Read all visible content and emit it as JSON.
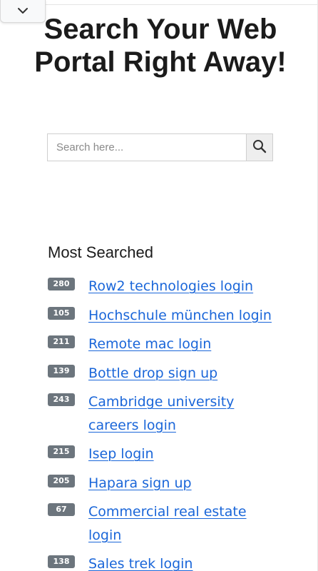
{
  "hero": {
    "title": "Search Your Web Portal Right Away!"
  },
  "search": {
    "placeholder": "Search here...",
    "value": ""
  },
  "most_searched": {
    "heading": "Most Searched",
    "items": [
      {
        "count": "280",
        "label": "Row2 technologies login"
      },
      {
        "count": "105",
        "label": "Hochschule münchen login"
      },
      {
        "count": "211",
        "label": "Remote mac login"
      },
      {
        "count": "139",
        "label": "Bottle drop sign up"
      },
      {
        "count": "243",
        "label": "Cambridge university careers login"
      },
      {
        "count": "215",
        "label": "Isep login"
      },
      {
        "count": "205",
        "label": "Hapara sign up"
      },
      {
        "count": "67",
        "label": "Commercial real estate login"
      },
      {
        "count": "138",
        "label": "Sales trek login"
      }
    ]
  },
  "colors": {
    "link": "#1a66d9",
    "badge": "#6c757d",
    "title": "#1b1b1b"
  },
  "icons": {
    "collapse": "chevron-down-icon",
    "search": "search-icon"
  }
}
